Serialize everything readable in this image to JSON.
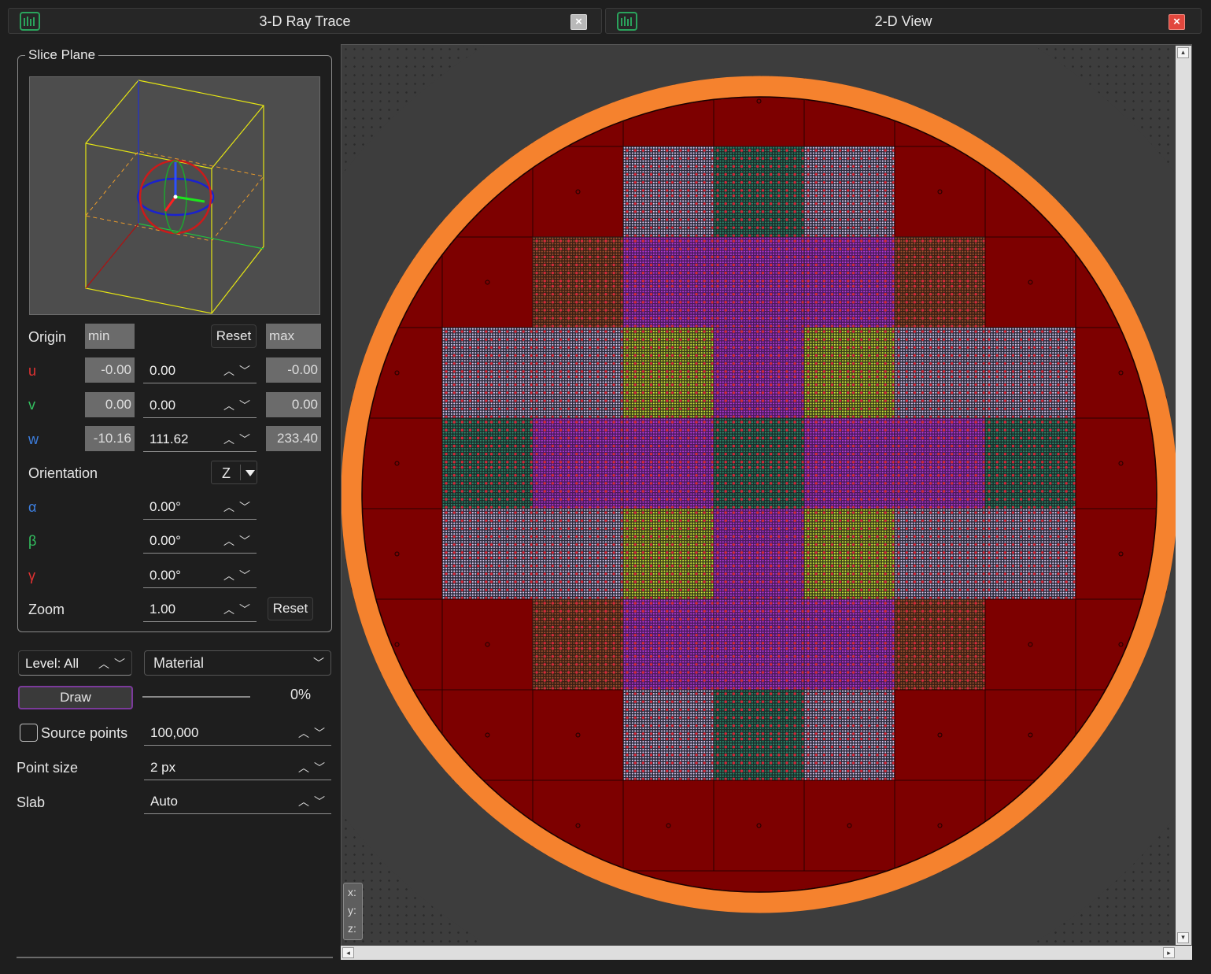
{
  "tabs": {
    "ray_trace": {
      "title": "3-D Ray Trace",
      "close": "×"
    },
    "view2d": {
      "title": "2-D View",
      "close": "×"
    }
  },
  "slice_plane": {
    "label": "Slice Plane",
    "origin_label": "Origin",
    "min_label": "min",
    "max_label": "max",
    "reset_label": "Reset",
    "u": {
      "label": "u",
      "min": "-0.00",
      "value": "0.00",
      "max": "-0.00"
    },
    "v": {
      "label": "v",
      "min": "0.00",
      "value": "0.00",
      "max": "0.00"
    },
    "w": {
      "label": "w",
      "min": "-10.16",
      "value": "111.62",
      "max": "233.40"
    },
    "orientation_label": "Orientation",
    "orientation_value": "Z",
    "alpha": {
      "label": "α",
      "value": "0.00°"
    },
    "beta": {
      "label": "β",
      "value": "0.00°"
    },
    "gamma": {
      "label": "γ",
      "value": "0.00°"
    },
    "zoom_label": "Zoom",
    "zoom_value": "1.00",
    "zoom_reset": "Reset"
  },
  "controls": {
    "level": "Level: All",
    "color_by": "Material",
    "draw_label": "Draw",
    "progress": "0%",
    "source_points_label": "Source points",
    "source_points_checked": false,
    "source_points_value": "100,000",
    "point_size_label": "Point size",
    "point_size_value": "2 px",
    "slab_label": "Slab",
    "slab_value": "Auto"
  },
  "coords": {
    "x": "x:",
    "y": "y:",
    "z": "z:"
  },
  "colors": {
    "reflector": "#7d0000",
    "outer_ring": "#f5822e",
    "fuel_red_dot": "#d82a3a",
    "fuel_magenta": "#b23ad6",
    "fuel_lavender": "#d9c8ef",
    "fuel_yellow": "#cbe53a",
    "fuel_teal": "#2e8a6e"
  },
  "core_map": [
    "RRRRRRRR",
    "..."
  ]
}
